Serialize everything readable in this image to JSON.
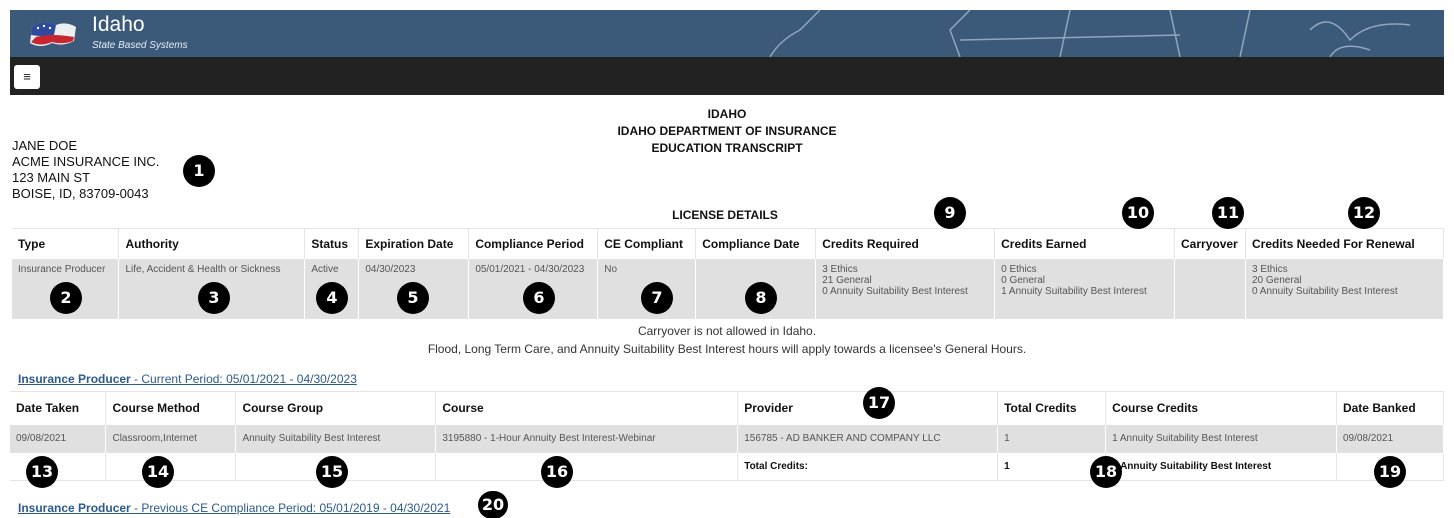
{
  "header": {
    "title": "Idaho",
    "subtitle": "State Based Systems"
  },
  "navbar": {
    "menu_label": "≡"
  },
  "report": {
    "state": "IDAHO",
    "department": "IDAHO DEPARTMENT OF INSURANCE",
    "doc_title": "EDUCATION TRANSCRIPT",
    "license_details_title": "LICENSE DETAILS"
  },
  "address": {
    "name": "JANE DOE",
    "company": "ACME INSURANCE INC.",
    "street": "123 MAIN ST",
    "city": "BOISE, ID, 83709-0043"
  },
  "license": {
    "headers": [
      "Type",
      "Authority",
      "Status",
      "Expiration Date",
      "Compliance Period",
      "CE Compliant",
      "Compliance Date",
      "Credits Required",
      "Credits Earned",
      "Carryover",
      "Credits Needed For Renewal"
    ],
    "row": {
      "type": "Insurance Producer",
      "authority": "Life, Accident & Health or Sickness",
      "status": "Active",
      "expiration": "04/30/2023",
      "period": "05/01/2021 - 04/30/2023",
      "compliant": "No",
      "compliance_date": "",
      "required": [
        "3 Ethics",
        "21 General",
        "0 Annuity Suitability Best Interest"
      ],
      "earned": [
        "0 Ethics",
        "0 General",
        "1 Annuity Suitability Best Interest"
      ],
      "carryover": "",
      "needed": [
        "3 Ethics",
        "20 General",
        "0 Annuity Suitability Best Interest"
      ]
    }
  },
  "notes": {
    "carryover": "Carryover is not allowed in Idaho.",
    "flood": "Flood, Long Term Care, and Annuity Suitability Best Interest hours will apply towards a licensee's General Hours."
  },
  "current_link": {
    "bold": "Insurance Producer",
    "rest": " - Current Period: 05/01/2021 - 04/30/2023"
  },
  "courses": {
    "headers": [
      "Date Taken",
      "Course Method",
      "Course Group",
      "Course",
      "Provider",
      "Total Credits",
      "Course Credits",
      "Date Banked"
    ],
    "row": {
      "date_taken": "09/08/2021",
      "method": "Classroom,Internet",
      "group": "Annuity Suitability Best Interest",
      "course": "3195880 - 1-Hour Annuity Best Interest-Webinar",
      "provider": "156785 - AD BANKER AND COMPANY LLC",
      "total": "1",
      "credits": "1 Annuity Suitability Best Interest",
      "banked": "09/08/2021"
    },
    "totals": {
      "label": "Total Credits:",
      "value": "1",
      "credits": "Annuity Suitability Best Interest"
    }
  },
  "previous_link": {
    "bold": "Insurance Producer",
    "rest": " - Previous CE Compliance Period: 05/01/2019 - 04/30/2021"
  },
  "badges": [
    "1",
    "2",
    "3",
    "4",
    "5",
    "6",
    "7",
    "8",
    "9",
    "10",
    "11",
    "12",
    "13",
    "14",
    "15",
    "16",
    "17",
    "18",
    "19",
    "20"
  ]
}
